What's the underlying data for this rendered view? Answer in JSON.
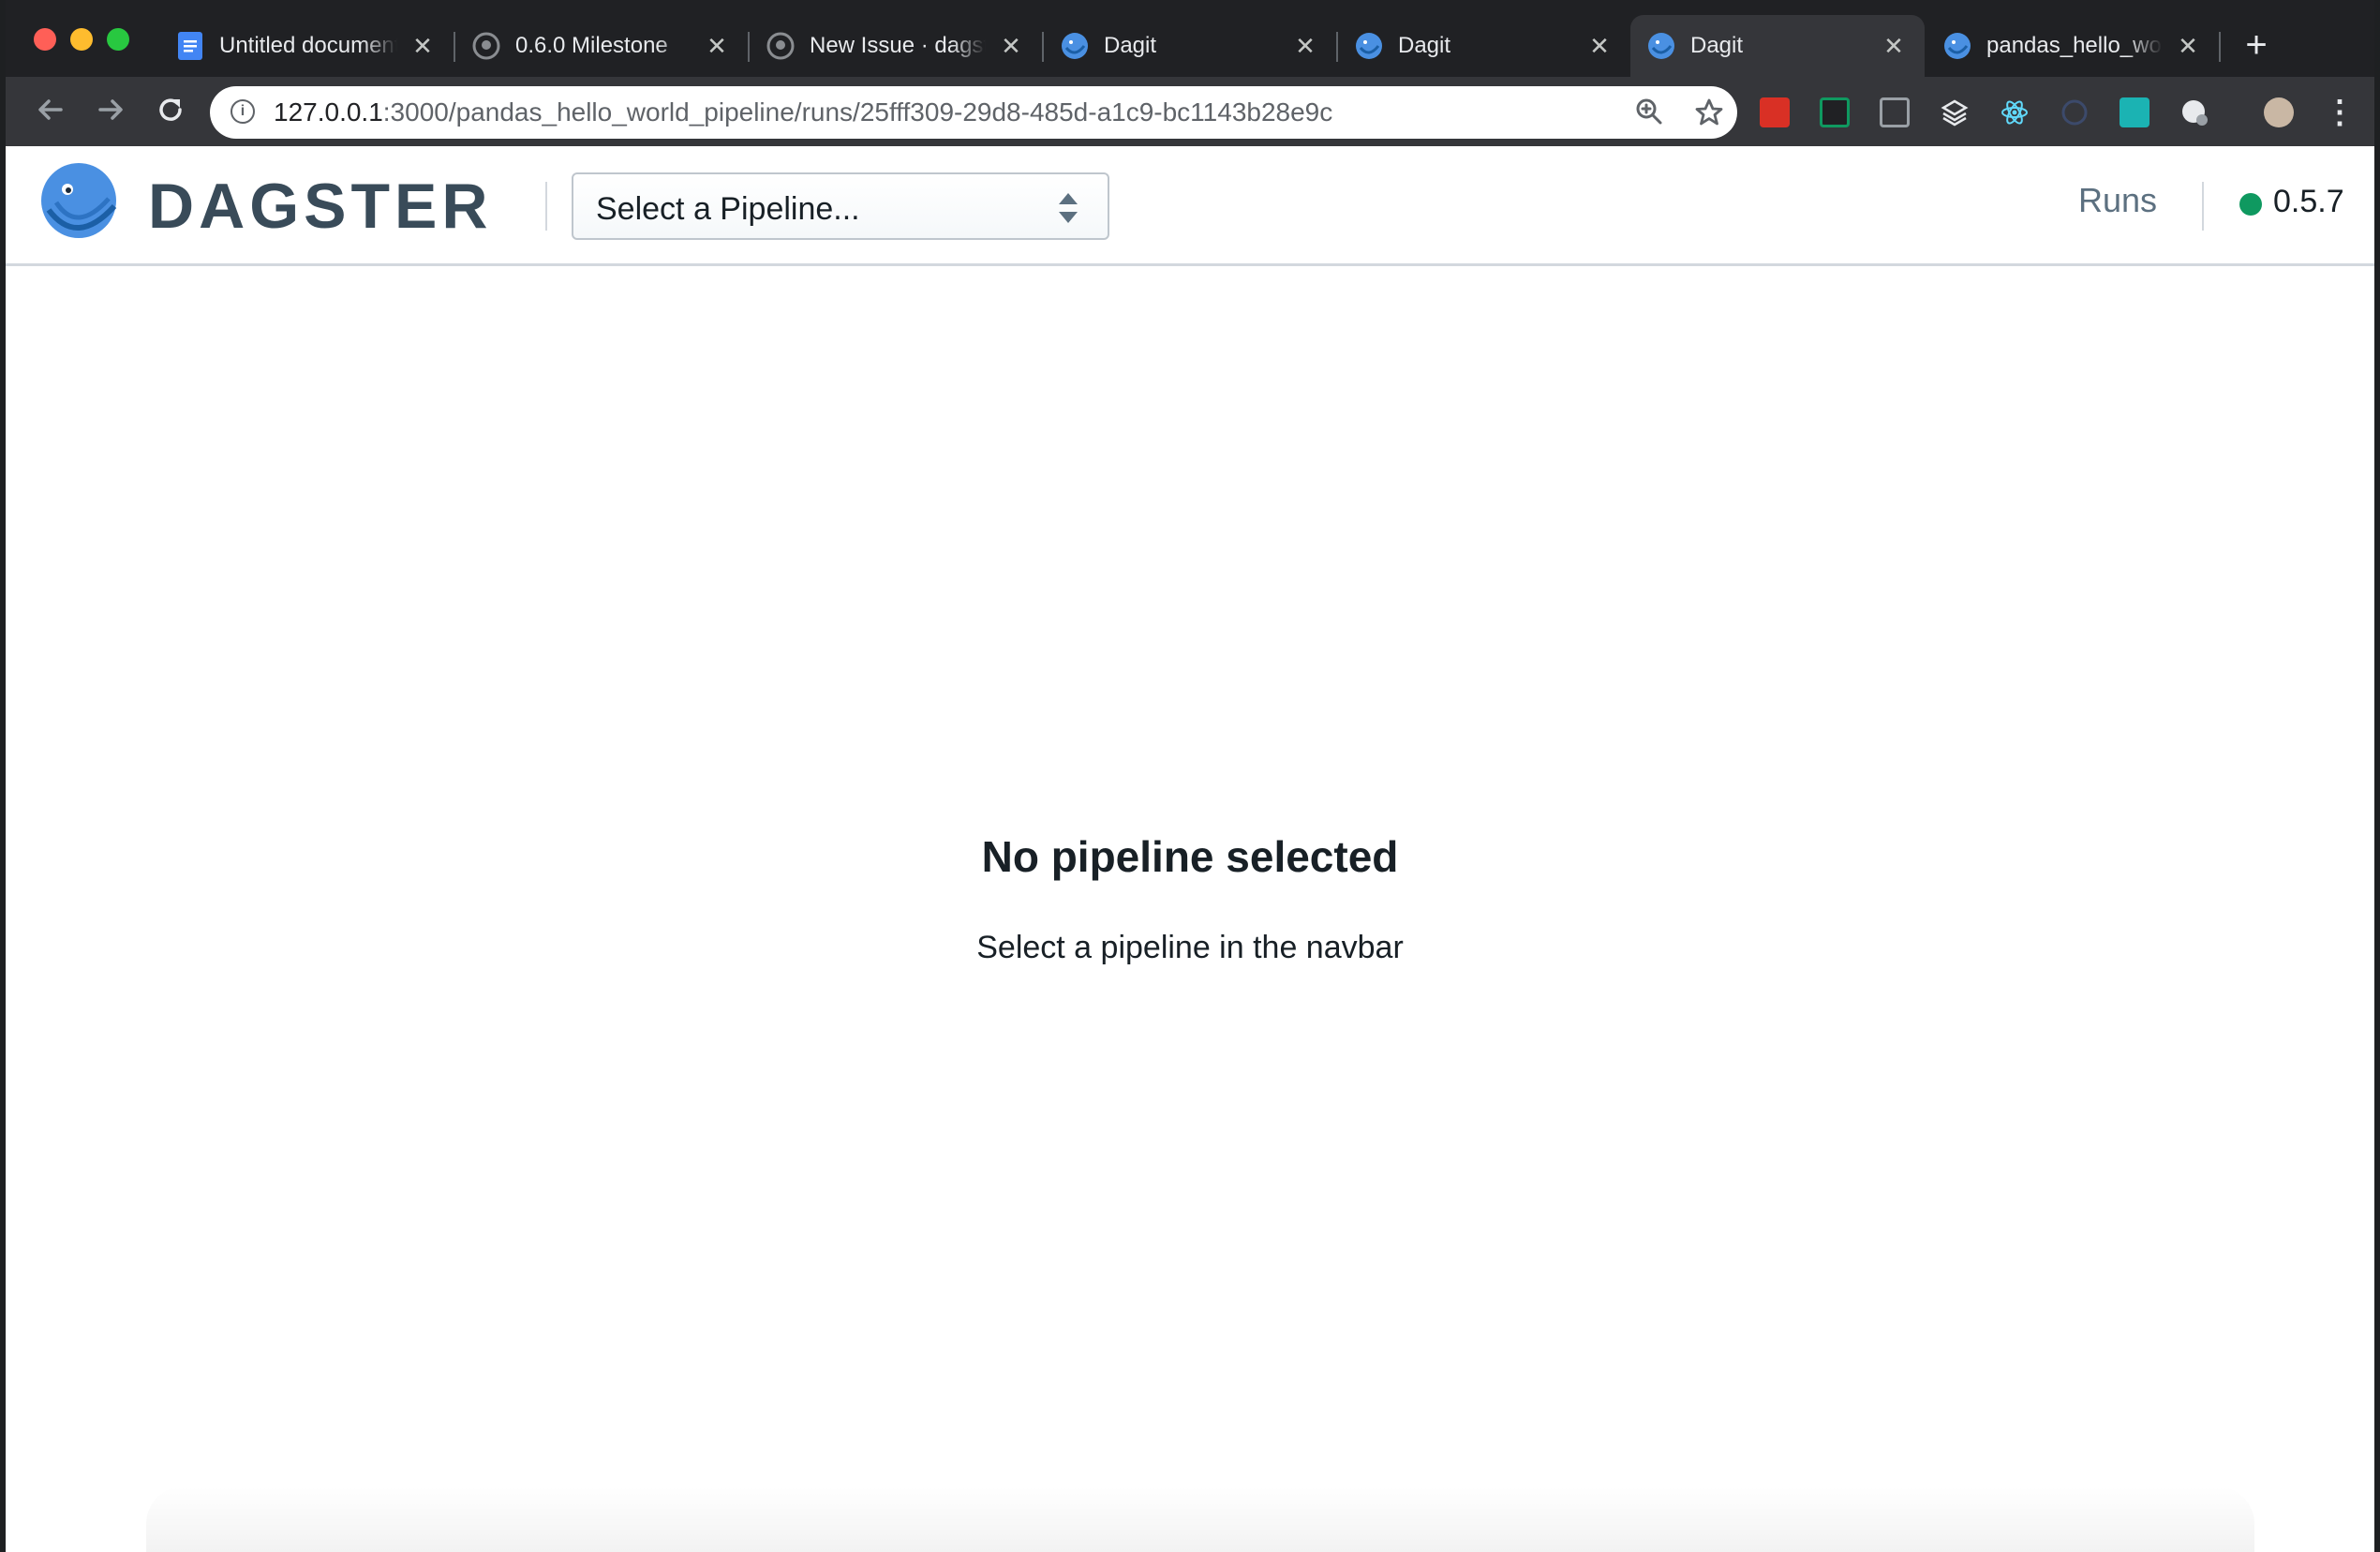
{
  "browser": {
    "tabs": [
      {
        "title": "Untitled document",
        "favicon": "google-docs-icon"
      },
      {
        "title": "0.6.0 Milestone",
        "favicon": "github-icon"
      },
      {
        "title": "New Issue · dagster",
        "favicon": "github-icon"
      },
      {
        "title": "Dagit",
        "favicon": "dagster-icon"
      },
      {
        "title": "Dagit",
        "favicon": "dagster-icon"
      },
      {
        "title": "Dagit",
        "favicon": "dagster-icon",
        "active": true
      },
      {
        "title": "pandas_hello_world",
        "favicon": "dagster-icon"
      }
    ],
    "close_glyph": "✕",
    "new_tab_glyph": "+",
    "url_host": "127.0.0.1",
    "url_rest": ":3000/pandas_hello_world_pipeline/runs/25fff309-29d8-485d-a1c9-bc1143b28e9c"
  },
  "navbar": {
    "brand": "DAGSTER",
    "pipeline_select_placeholder": "Select a Pipeline...",
    "runs_link": "Runs",
    "version": "0.5.7",
    "status_color": "#0f9960"
  },
  "main": {
    "empty_title": "No pipeline selected",
    "empty_description": "Select a pipeline in the navbar"
  }
}
